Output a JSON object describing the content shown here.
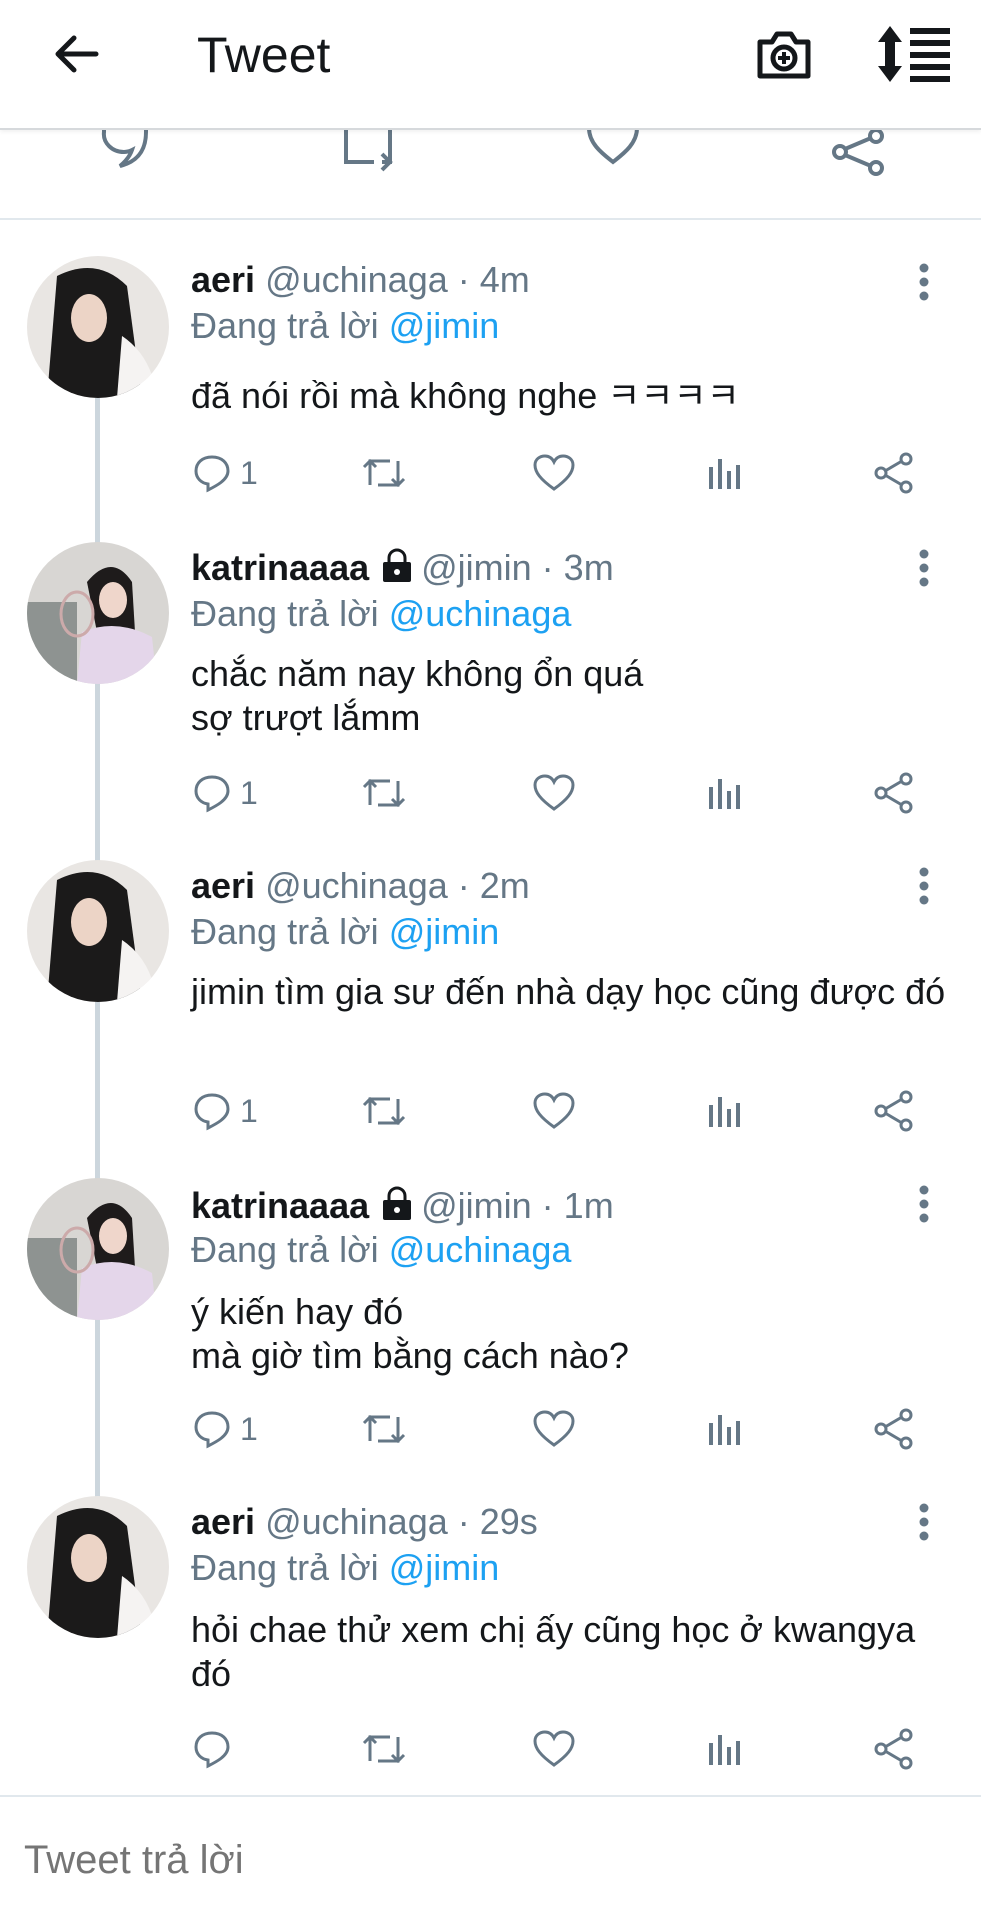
{
  "header": {
    "title": "Tweet",
    "back_icon": "arrow-left-icon",
    "camera_icon": "camera-add-icon",
    "sort_icon": "sort-icon"
  },
  "colors": {
    "link": "#1da1f2",
    "muted": "#657786",
    "text": "#14171a",
    "line": "#ccd6dd"
  },
  "replies": [
    {
      "name": "aeri",
      "handle": "@uchinaga · 4m",
      "locked": false,
      "replying_prefix": "Đang trả lời",
      "replying_to": "@jimin",
      "body": "đã nói rồi mà không nghe ㅋㅋㅋㅋ",
      "reply_count": "1"
    },
    {
      "name": "katrinaaaa",
      "handle": "@jimin · 3m",
      "locked": true,
      "replying_prefix": "Đang trả lời",
      "replying_to": "@uchinaga",
      "body": "chắc năm nay không ổn quá\nsợ trượt lắmm",
      "reply_count": "1"
    },
    {
      "name": "aeri",
      "handle": "@uchinaga · 2m",
      "locked": false,
      "replying_prefix": "Đang trả lời",
      "replying_to": "@jimin",
      "body": "jimin tìm gia sư đến nhà dạy học cũng được đó",
      "reply_count": "1"
    },
    {
      "name": "katrinaaaa",
      "handle": "@jimin · 1m",
      "locked": true,
      "replying_prefix": "Đang trả lời",
      "replying_to": "@uchinaga",
      "body": "ý kiến hay đó\nmà giờ tìm bằng cách nào?",
      "reply_count": "1"
    },
    {
      "name": "aeri",
      "handle": "@uchinaga · 29s",
      "locked": false,
      "replying_prefix": "Đang trả lời",
      "replying_to": "@jimin",
      "body": "hỏi chae thử xem chị ấy cũng học ở kwangya đó",
      "reply_count": ""
    }
  ],
  "composer": {
    "placeholder": "Tweet trả lời"
  }
}
